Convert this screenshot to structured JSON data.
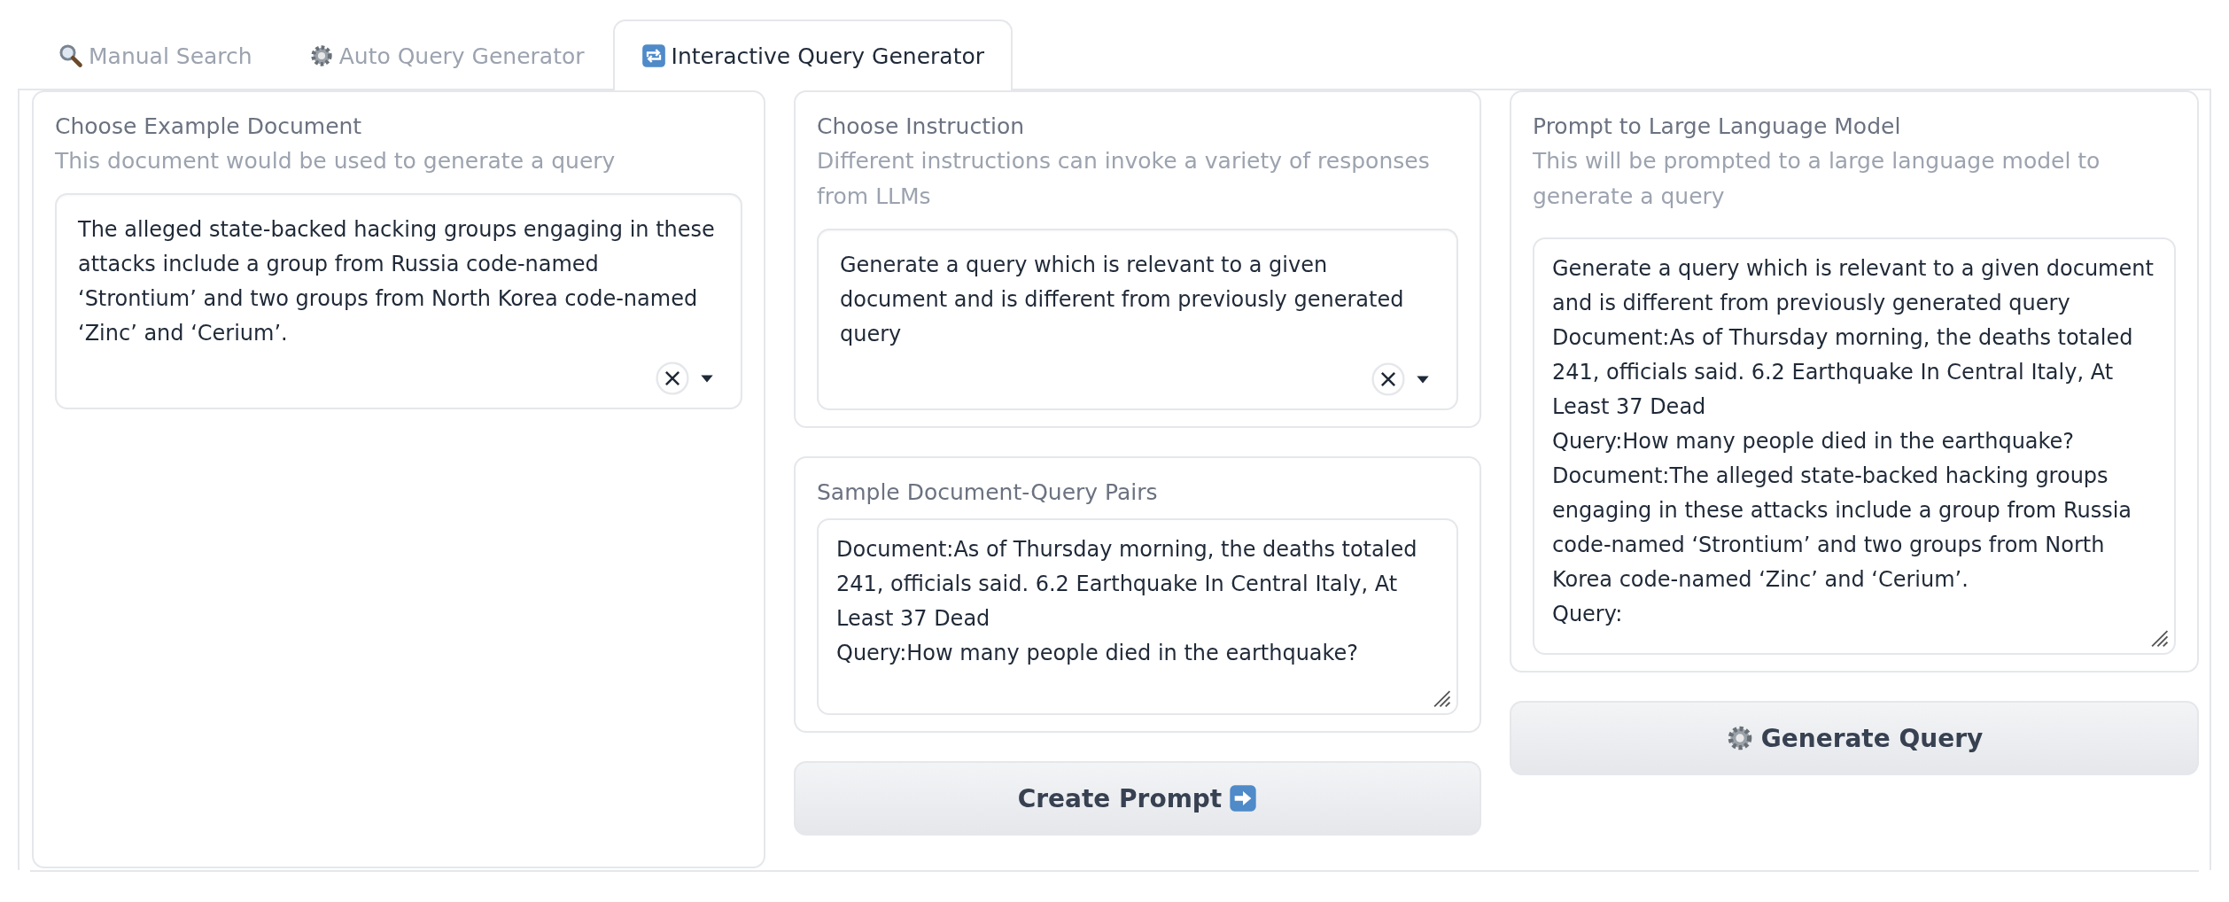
{
  "tabs": [
    {
      "label": "Manual Search",
      "kind": "search",
      "selected": false
    },
    {
      "label": "Auto Query Generator",
      "kind": "gear",
      "selected": false
    },
    {
      "label": "Interactive Query Generator",
      "kind": "repeat",
      "selected": true
    }
  ],
  "example_document": {
    "label": "Choose Example Document",
    "info": "This document would be used to generate a query",
    "value": "The alleged state-backed hacking groups engaging in these attacks include a group from Russia code-named ‘Strontium’ and two groups from North Korea code-named ‘Zinc’ and ‘Cerium’."
  },
  "instruction": {
    "label": "Choose Instruction",
    "info": "Different instructions can invoke a variety of responses from LLMs",
    "value": "Generate a query which is relevant to a given document and is different from previously generated query"
  },
  "sample_pairs": {
    "label": "Sample Document-Query Pairs",
    "value": "Document:As of Thursday morning, the deaths totaled 241, officials said. 6.2 Earthquake In Central Italy, At Least 37 Dead\nQuery:How many people died in the earthquake?"
  },
  "create_button": {
    "label": "Create Prompt",
    "kind": "arrow"
  },
  "prompt": {
    "label": "Prompt to Large Language Model",
    "info": "This will be prompted to a large language model to generate a query",
    "value": "Generate a query which is relevant to a given document and is different from previously generated query\nDocument:As of Thursday morning, the deaths totaled 241, officials said. 6.2 Earthquake In Central Italy, At Least 37 Dead\nQuery:How many people died in the earthquake?\nDocument:The alleged state-backed hacking groups engaging in these attacks include a group from Russia code-named ‘Strontium’ and two groups from North Korea code-named ‘Zinc’ and ‘Cerium’.\nQuery:"
  },
  "generate_button": {
    "label": "Generate Query",
    "kind": "gear"
  }
}
